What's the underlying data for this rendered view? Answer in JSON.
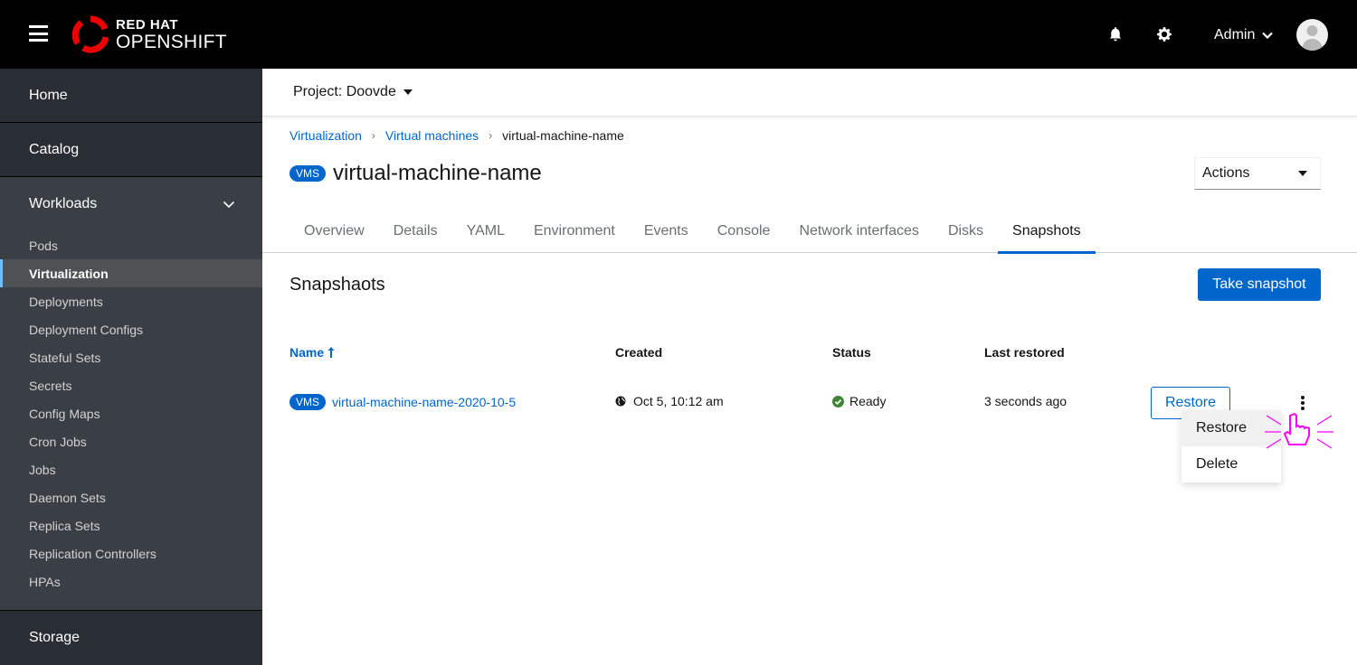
{
  "masthead": {
    "logo_line1": "RED HAT",
    "logo_line2": "OPENSHIFT",
    "user": "Admin",
    "icons": [
      "hamburger-icon",
      "bell-icon",
      "gear-icon",
      "chevron-down-icon",
      "avatar"
    ]
  },
  "sidebar": {
    "home": "Home",
    "catalog": "Catalog",
    "workloads": {
      "label": "Workloads",
      "expanded": true,
      "items": [
        {
          "label": "Pods"
        },
        {
          "label": "Virtualization",
          "active": true
        },
        {
          "label": "Deployments"
        },
        {
          "label": "Deployment Configs"
        },
        {
          "label": "Stateful Sets"
        },
        {
          "label": "Secrets"
        },
        {
          "label": "Config Maps"
        },
        {
          "label": "Cron Jobs"
        },
        {
          "label": "Jobs"
        },
        {
          "label": "Daemon Sets"
        },
        {
          "label": "Replica Sets"
        },
        {
          "label": "Replication Controllers"
        },
        {
          "label": "HPAs"
        }
      ]
    },
    "storage": "Storage"
  },
  "project": {
    "label": "Project:",
    "value": "Doovde"
  },
  "breadcrumb": [
    {
      "label": "Virtualization"
    },
    {
      "label": "Virtual machines"
    },
    {
      "label": "virtual-machine-name"
    }
  ],
  "header": {
    "badge": "VMS",
    "title": "virtual-machine-name",
    "actions_label": "Actions"
  },
  "tabs": [
    {
      "label": "Overview"
    },
    {
      "label": "Details"
    },
    {
      "label": "YAML"
    },
    {
      "label": "Environment"
    },
    {
      "label": "Events"
    },
    {
      "label": "Console"
    },
    {
      "label": "Network interfaces"
    },
    {
      "label": "Disks"
    },
    {
      "label": "Snapshots",
      "active": true
    }
  ],
  "snapshots": {
    "title": "Snapshaots",
    "take_button": "Take snapshot",
    "columns": {
      "name": "Name",
      "created": "Created",
      "status": "Status",
      "last_restored": "Last restored"
    },
    "rows": [
      {
        "badge": "VMS",
        "name": "virtual-machine-name-2020-10-5",
        "created": "Oct 5, 10:12 am",
        "status": "Ready",
        "last_restored": "3 seconds ago",
        "restore_button": "Restore"
      }
    ],
    "kebab_menu": [
      {
        "label": "Restore",
        "hovered": true
      },
      {
        "label": "Delete"
      }
    ]
  },
  "colors": {
    "primary": "#0066cc",
    "success": "#3e8635",
    "masthead": "#000000",
    "sidebar": "#212427",
    "cursor_highlight": "#ff00ff"
  }
}
